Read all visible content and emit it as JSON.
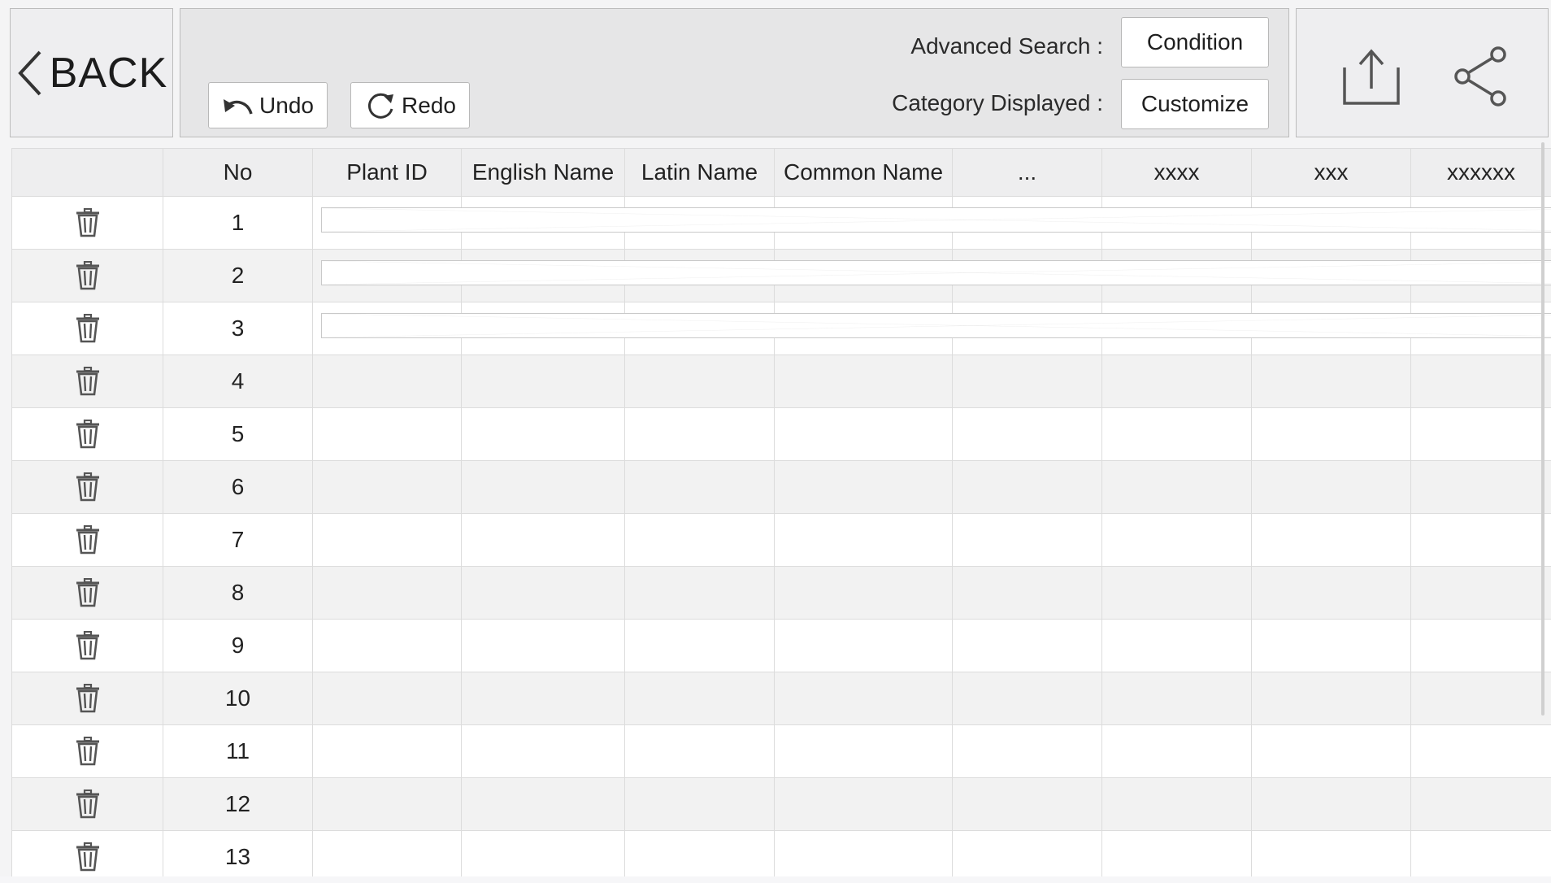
{
  "nav": {
    "back_label": "BACK"
  },
  "toolbar": {
    "undo_label": "Undo",
    "redo_label": "Redo",
    "advanced_search_label": "Advanced Search :",
    "condition_label": "Condition",
    "category_displayed_label": "Category Displayed :",
    "customize_label": "Customize"
  },
  "icons": {
    "back": "chevron-left-icon",
    "undo": "undo-arrow-icon",
    "redo": "redo-circle-icon",
    "upload": "upload-icon",
    "share": "share-icon",
    "delete": "trash-icon"
  },
  "table": {
    "columns": [
      "",
      "No",
      "Plant ID",
      "English Name",
      "Latin Name",
      "Common Name",
      "...",
      "xxxx",
      "xxx",
      "xxxxxx"
    ],
    "rows": [
      {
        "no": "1",
        "filled": true
      },
      {
        "no": "2",
        "filled": true
      },
      {
        "no": "3",
        "filled": true
      },
      {
        "no": "4",
        "filled": false
      },
      {
        "no": "5",
        "filled": false
      },
      {
        "no": "6",
        "filled": false
      },
      {
        "no": "7",
        "filled": false
      },
      {
        "no": "8",
        "filled": false
      },
      {
        "no": "9",
        "filled": false
      },
      {
        "no": "10",
        "filled": false
      },
      {
        "no": "11",
        "filled": false
      },
      {
        "no": "12",
        "filled": false
      },
      {
        "no": "13",
        "filled": false
      }
    ]
  }
}
